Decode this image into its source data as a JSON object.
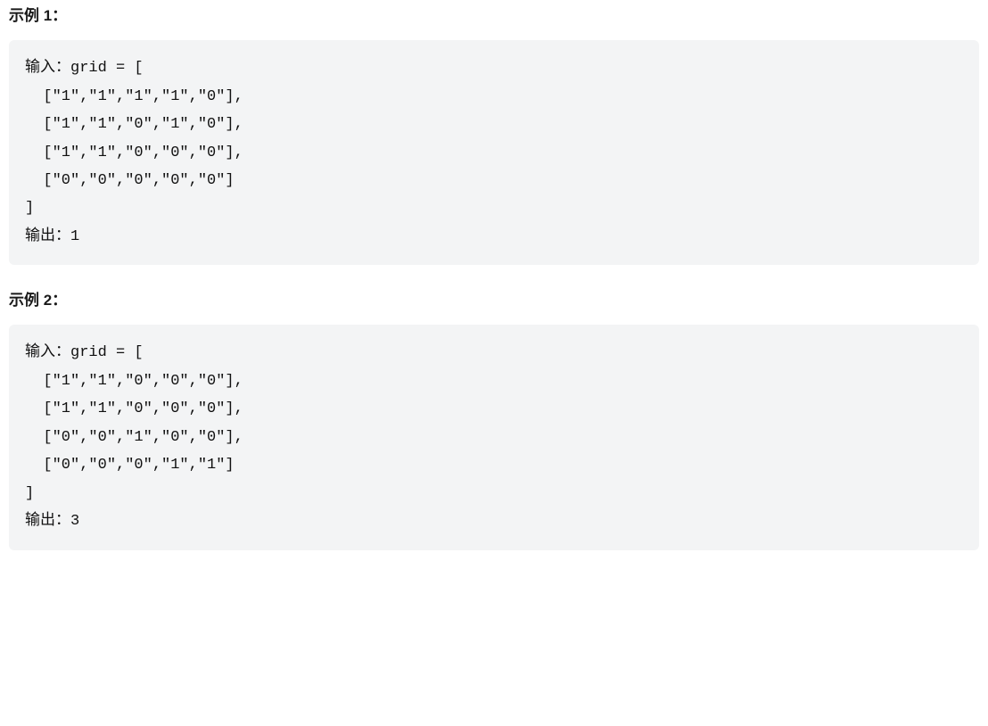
{
  "examples": [
    {
      "label": "示例 1：",
      "code": "输入：grid = [\n  [\"1\",\"1\",\"1\",\"1\",\"0\"],\n  [\"1\",\"1\",\"0\",\"1\",\"0\"],\n  [\"1\",\"1\",\"0\",\"0\",\"0\"],\n  [\"0\",\"0\",\"0\",\"0\",\"0\"]\n]\n输出：1"
    },
    {
      "label": "示例 2：",
      "code": "输入：grid = [\n  [\"1\",\"1\",\"0\",\"0\",\"0\"],\n  [\"1\",\"1\",\"0\",\"0\",\"0\"],\n  [\"0\",\"0\",\"1\",\"0\",\"0\"],\n  [\"0\",\"0\",\"0\",\"1\",\"1\"]\n]\n输出：3"
    }
  ]
}
